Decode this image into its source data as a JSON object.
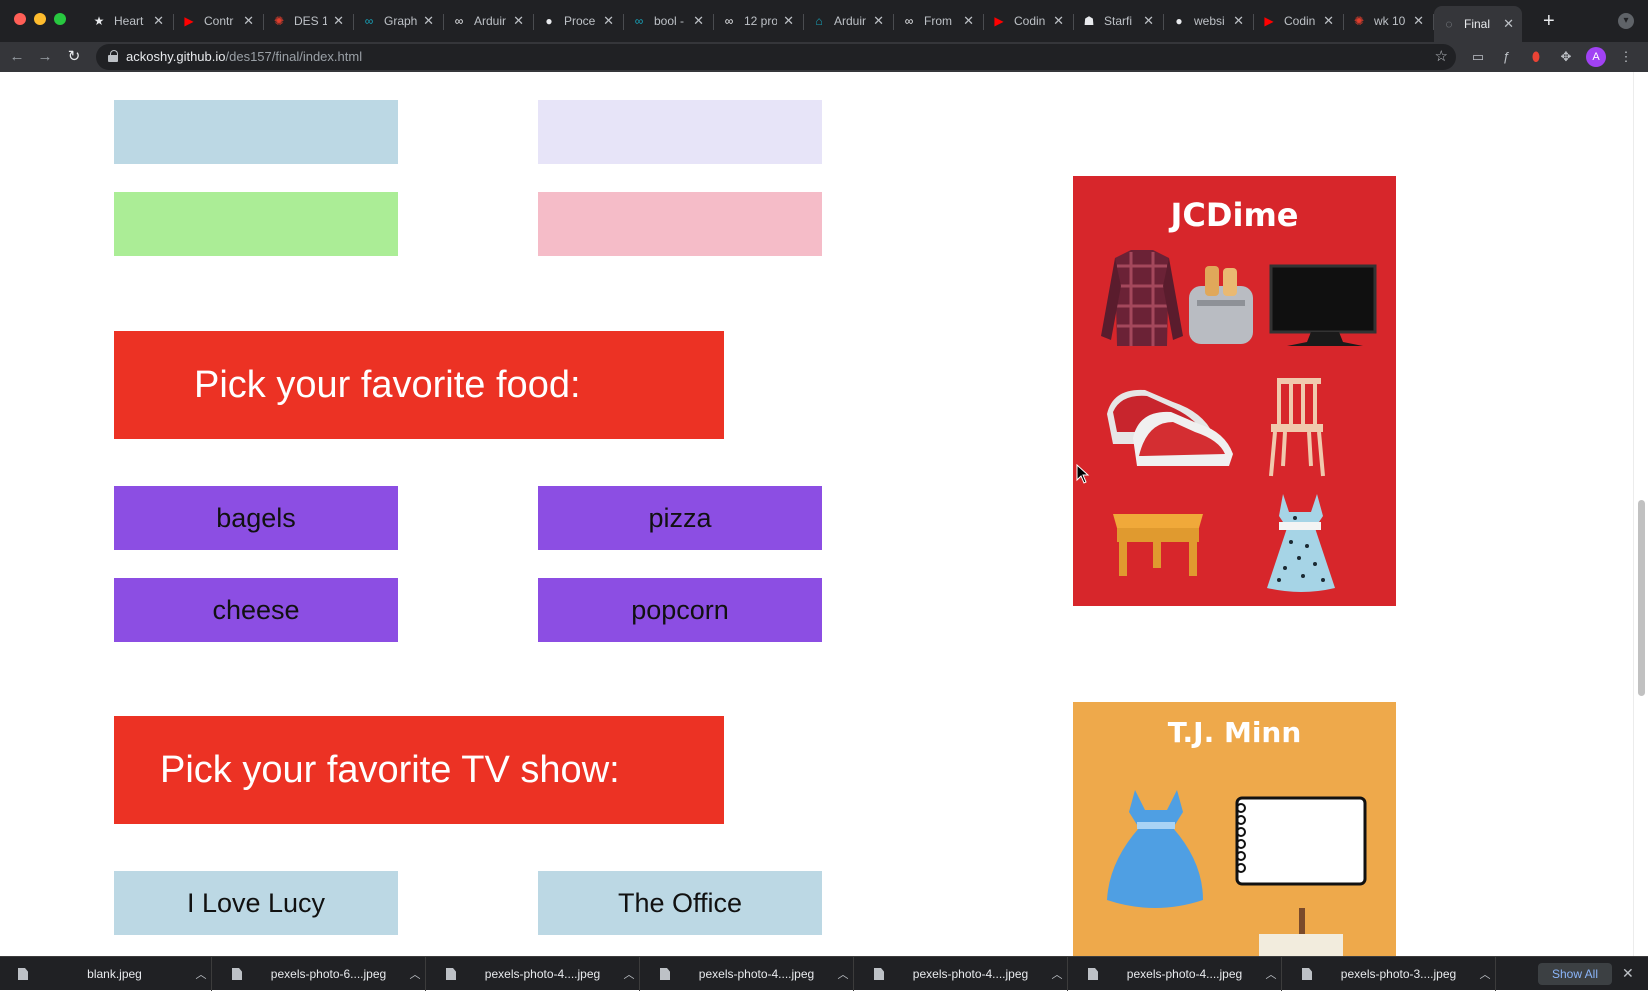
{
  "browser": {
    "tabs": [
      {
        "icon": "star-icon",
        "glyph": "★",
        "title": "Heart",
        "color": "#e8eaed"
      },
      {
        "icon": "youtube-icon",
        "glyph": "▶",
        "title": "Contr",
        "color": "#ff0000"
      },
      {
        "icon": "canvas-icon",
        "glyph": "✺",
        "title": "DES 1",
        "color": "#e03e2d"
      },
      {
        "icon": "arduino-icon",
        "glyph": "∞",
        "title": "Graph",
        "color": "#17a2b8"
      },
      {
        "icon": "infinity-icon",
        "glyph": "∞",
        "title": "Arduir",
        "color": "#e8eaed"
      },
      {
        "icon": "github-icon",
        "glyph": "●",
        "title": "Proce",
        "color": "#e8eaed"
      },
      {
        "icon": "arduino-icon",
        "glyph": "∞",
        "title": "bool -",
        "color": "#17a2b8"
      },
      {
        "icon": "infinity-icon",
        "glyph": "∞",
        "title": "12 pro",
        "color": "#e8eaed"
      },
      {
        "icon": "arduino-project-icon",
        "glyph": "⌂",
        "title": "Arduir",
        "color": "#17a2b8"
      },
      {
        "icon": "infinity-icon",
        "glyph": "∞",
        "title": "From",
        "color": "#e8eaed"
      },
      {
        "icon": "youtube-icon",
        "glyph": "▶",
        "title": "Codin",
        "color": "#ff0000"
      },
      {
        "icon": "robot-icon",
        "glyph": "☗",
        "title": "Starfi",
        "color": "#e8eaed"
      },
      {
        "icon": "github-icon",
        "glyph": "●",
        "title": "websi",
        "color": "#e8eaed"
      },
      {
        "icon": "youtube-icon",
        "glyph": "▶",
        "title": "Codin",
        "color": "#ff0000"
      },
      {
        "icon": "canvas-icon",
        "glyph": "✺",
        "title": "wk 10",
        "color": "#e03e2d"
      },
      {
        "icon": "globe-icon",
        "glyph": "◌",
        "title": "Final",
        "color": "#9aa0a6"
      }
    ],
    "url_host": "ackoshy.github.io",
    "url_path": "/des157/final/index.html",
    "avatar_letter": "A"
  },
  "page": {
    "top_options": [
      {
        "label": "",
        "color": "#bcd8e4"
      },
      {
        "label": "",
        "color": "#e7e4f8"
      },
      {
        "label": "",
        "color": "#abed96"
      },
      {
        "label": "",
        "color": "#f5bcc8"
      }
    ],
    "food": {
      "heading": "Pick your favorite food:",
      "options": [
        "bagels",
        "pizza",
        "cheese",
        "popcorn"
      ],
      "color": "#8c4ee3"
    },
    "tv": {
      "heading": "Pick your favorite TV show:",
      "options": [
        "I Love Lucy",
        "The Office"
      ],
      "color": "#bcd8e4"
    },
    "heading_color": "#ec3224",
    "ads": [
      {
        "title": "JCDime",
        "bg": "#d7262b"
      },
      {
        "title": "T.J. Minn",
        "bg": "#eea94b"
      }
    ]
  },
  "downloads": {
    "files": [
      "blank.jpeg",
      "pexels-photo-6....jpeg",
      "pexels-photo-4....jpeg",
      "pexels-photo-4....jpeg",
      "pexels-photo-4....jpeg",
      "pexels-photo-4....jpeg",
      "pexels-photo-3....jpeg"
    ],
    "show_all": "Show All"
  }
}
